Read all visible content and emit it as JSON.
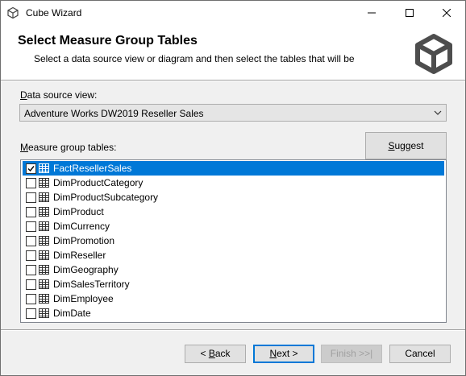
{
  "window": {
    "title": "Cube Wizard"
  },
  "header": {
    "title": "Select Measure Group Tables",
    "subtitle": "Select a data source view or diagram and then select the tables that will be"
  },
  "datasource": {
    "label_accel": "D",
    "label_rest": "ata source view:",
    "selected": "Adventure Works DW2019 Reseller Sales"
  },
  "tables": {
    "label_accel": "M",
    "label_rest": "easure group tables:",
    "suggest_accel": "S",
    "suggest_rest": "uggest",
    "items": [
      {
        "name": "FactResellerSales",
        "checked": true,
        "selected": true
      },
      {
        "name": "DimProductCategory",
        "checked": false
      },
      {
        "name": "DimProductSubcategory",
        "checked": false
      },
      {
        "name": "DimProduct",
        "checked": false
      },
      {
        "name": "DimCurrency",
        "checked": false
      },
      {
        "name": "DimPromotion",
        "checked": false
      },
      {
        "name": "DimReseller",
        "checked": false
      },
      {
        "name": "DimGeography",
        "checked": false
      },
      {
        "name": "DimSalesTerritory",
        "checked": false
      },
      {
        "name": "DimEmployee",
        "checked": false
      },
      {
        "name": "DimDate",
        "checked": false
      }
    ]
  },
  "buttons": {
    "back_prefix": "< ",
    "back_accel": "B",
    "back_rest": "ack",
    "next_accel": "N",
    "next_rest": "ext >",
    "finish": "Finish >>|",
    "cancel": "Cancel"
  },
  "colors": {
    "selection": "#0078d7",
    "background": "#f0f0f0"
  },
  "icons": {
    "app": "cube-icon",
    "header": "cube-icon",
    "table": "table-grid-icon",
    "minimize": "minimize-icon",
    "maximize": "maximize-icon",
    "close": "close-icon",
    "dropdown": "chevron-down-icon"
  }
}
